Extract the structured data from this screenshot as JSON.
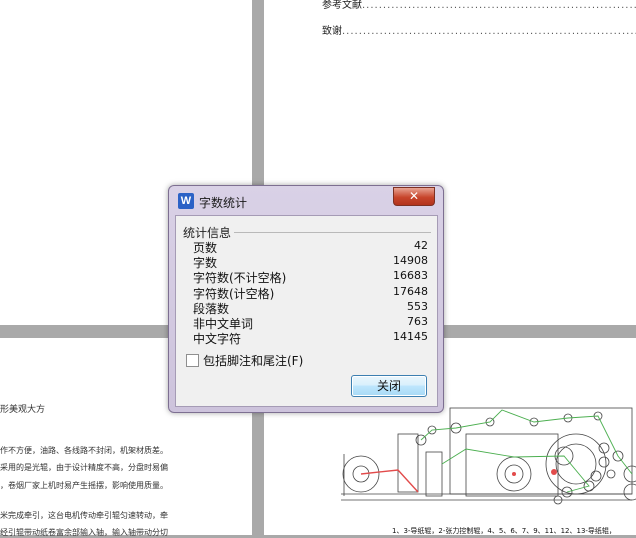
{
  "document": {
    "toc": [
      {
        "label": "参考文献",
        "dots": "......................................................................"
      },
      {
        "label": "致谢",
        "dots": "..............................................................................."
      }
    ],
    "left_text": [
      "形美观大方",
      "作不方便，油路、各线路不封闭，机架材质差。",
      "采用的是光辊，由于设计精度不高，分盘时易偏",
      "，卷烟厂家上机时易产生摇摆，影响使用质量。",
      "米完成牵引，这台电机传动牵引辊匀速转动，牵",
      "经引辊带动纸卷富余部输入轴，输入轴带动分切"
    ],
    "figure_caption": "1、3-导纸辊，2-张力控制辊，4、5、6、7、9、11、12、13-导纸辊，"
  },
  "dialog": {
    "title": "字数统计",
    "app_icon": "W",
    "close_glyph": "✕",
    "group_label": "统计信息",
    "stats": [
      {
        "label": "页数",
        "value": "42"
      },
      {
        "label": "字数",
        "value": "14908"
      },
      {
        "label": "字符数(不计空格)",
        "value": "16683"
      },
      {
        "label": "字符数(计空格)",
        "value": "17648"
      },
      {
        "label": "段落数",
        "value": "553"
      },
      {
        "label": "非中文单词",
        "value": "763"
      },
      {
        "label": "中文字符",
        "value": "14145"
      }
    ],
    "checkbox_label": "包括脚注和尾注(F)",
    "checkbox_checked": false,
    "close_button": "关闭"
  }
}
